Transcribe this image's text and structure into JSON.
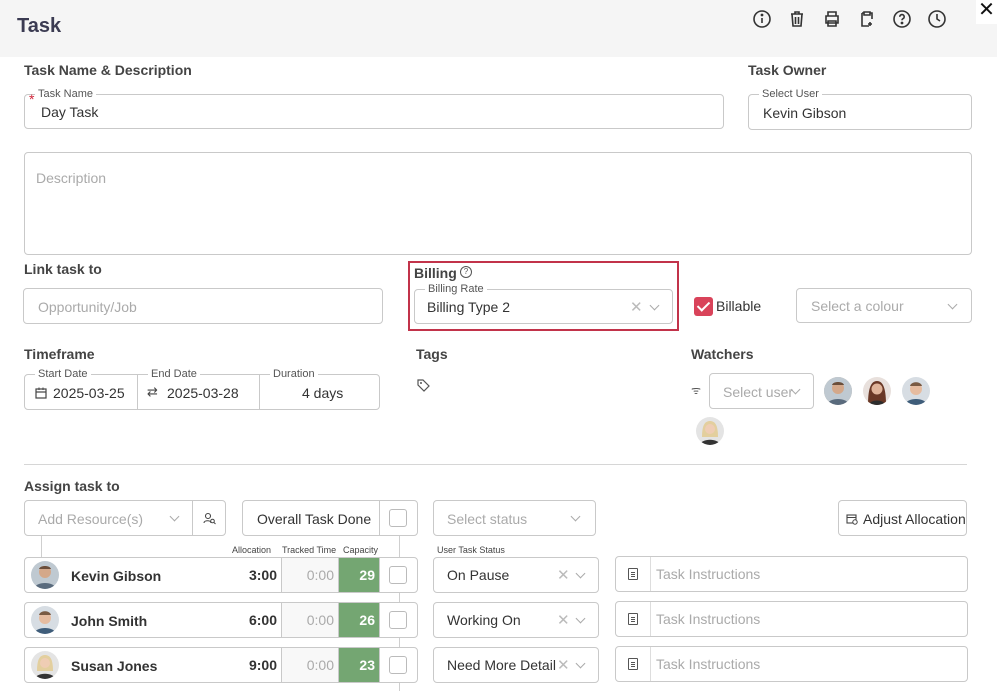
{
  "header": {
    "title": "Task"
  },
  "task_name_section": {
    "heading": "Task Name & Description",
    "name_label": "Task Name",
    "name_value": "Day Task",
    "required_mark": "*",
    "description_placeholder": "Description"
  },
  "owner": {
    "heading": "Task Owner",
    "label": "Select User",
    "value": "Kevin Gibson"
  },
  "link": {
    "heading": "Link task to",
    "placeholder": "Opportunity/Job"
  },
  "billing": {
    "heading": "Billing",
    "rate_label": "Billing Rate",
    "rate_value": "Billing Type 2",
    "billable_label": "Billable",
    "billable_checked": true,
    "colour_placeholder": "Select a colour"
  },
  "timeframe": {
    "heading": "Timeframe",
    "start_label": "Start Date",
    "start_value": "2025-03-25",
    "end_label": "End Date",
    "end_value": "2025-03-28",
    "duration_label": "Duration",
    "duration_value": "4 days"
  },
  "tags": {
    "heading": "Tags"
  },
  "watchers": {
    "heading": "Watchers",
    "placeholder": "Select user"
  },
  "assign": {
    "heading": "Assign task to",
    "resource_placeholder": "Add Resource(s)",
    "overall_done_label": "Overall Task Done",
    "status_placeholder": "Select status",
    "adjust_label": "Adjust Allocation",
    "col_allocation": "Allocation",
    "col_tracked": "Tracked Time",
    "col_capacity": "Capacity",
    "col_user_status": "User Task Status",
    "instructions_placeholder": "Task Instructions",
    "rows": [
      {
        "name": "Kevin Gibson",
        "allocation": "3:00",
        "tracked": "0:00",
        "capacity": "29",
        "status": "On Pause"
      },
      {
        "name": "John Smith",
        "allocation": "6:00",
        "tracked": "0:00",
        "capacity": "26",
        "status": "Working On"
      },
      {
        "name": "Susan Jones",
        "allocation": "9:00",
        "tracked": "0:00",
        "capacity": "23",
        "status": "Need More Detail"
      }
    ]
  },
  "colors": {
    "accent_red": "#c2334a",
    "capacity_green": "#74a672"
  }
}
